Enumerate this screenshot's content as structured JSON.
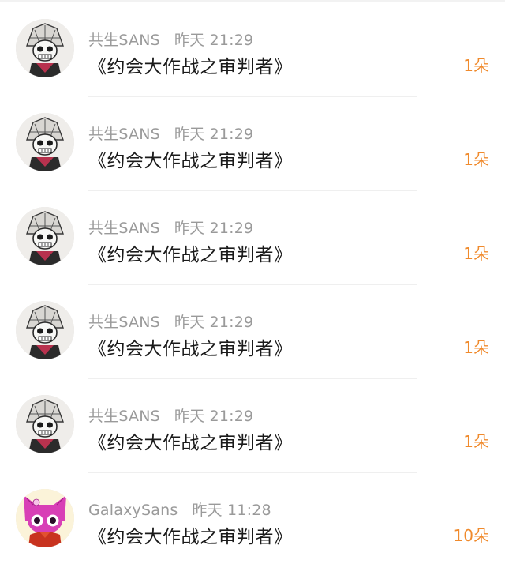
{
  "rows": [
    {
      "user": "共生SANS",
      "time": "昨天 21:29",
      "title": "《约会大作战之审判者》",
      "count": "1朵",
      "avatar": "sketch-skull-avatar"
    },
    {
      "user": "共生SANS",
      "time": "昨天 21:29",
      "title": "《约会大作战之审判者》",
      "count": "1朵",
      "avatar": "sketch-skull-avatar"
    },
    {
      "user": "共生SANS",
      "time": "昨天 21:29",
      "title": "《约会大作战之审判者》",
      "count": "1朵",
      "avatar": "sketch-skull-avatar"
    },
    {
      "user": "共生SANS",
      "time": "昨天 21:29",
      "title": "《约会大作战之审判者》",
      "count": "1朵",
      "avatar": "sketch-skull-avatar"
    },
    {
      "user": "共生SANS",
      "time": "昨天 21:29",
      "title": "《约会大作战之审判者》",
      "count": "1朵",
      "avatar": "sketch-skull-avatar"
    },
    {
      "user": "GalaxySans",
      "time": "昨天 11:28",
      "title": "《约会大作战之审判者》",
      "count": "10朵",
      "avatar": "pink-cat-skull-avatar"
    }
  ],
  "colors": {
    "meta": "#9a9a9a",
    "title": "#1a1a1a",
    "count": "#f08a2c",
    "divider": "#efefef"
  }
}
